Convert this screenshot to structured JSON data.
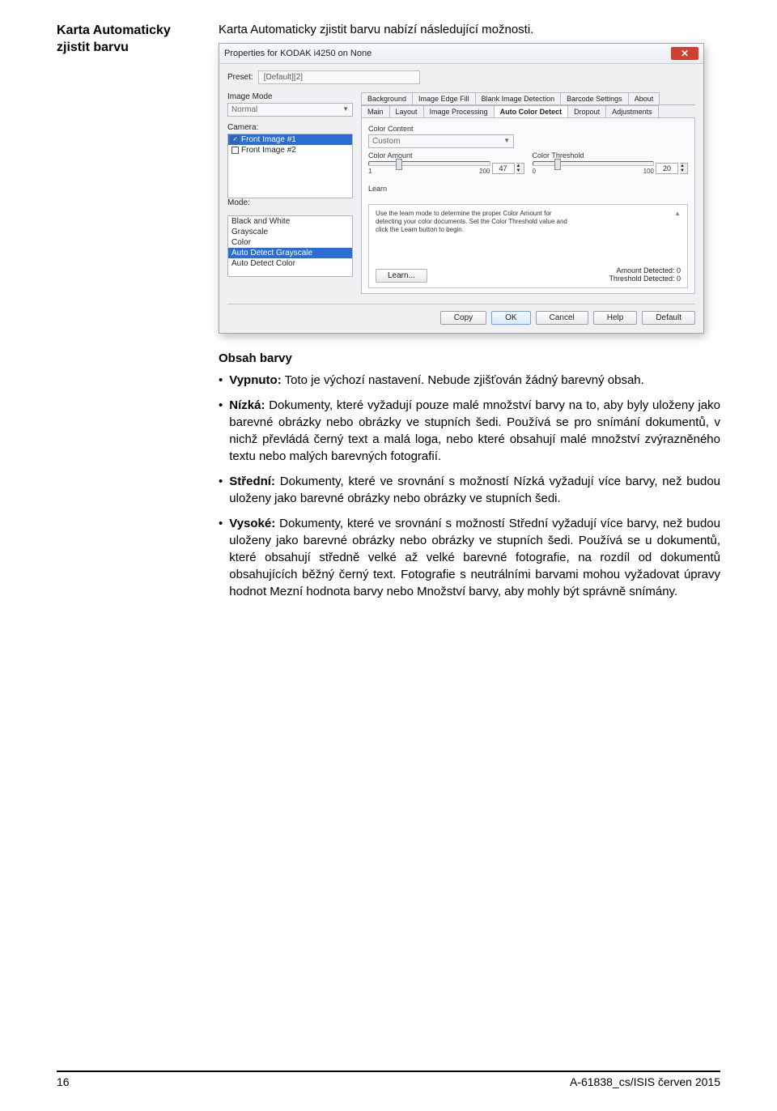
{
  "side_heading": "Karta Automaticky zjistit barvu",
  "intro": "Karta Automaticky zjistit barvu nabízí následující možnosti.",
  "dialog": {
    "title": "Properties for KODAK i4250 on None",
    "preset_label": "Preset:",
    "preset_value": "[Default][2]",
    "image_mode_label": "Image Mode",
    "image_mode_value": "Normal",
    "camera_label": "Camera:",
    "camera_items": [
      "Front Image #1",
      "Front Image #2"
    ],
    "mode_label": "Mode:",
    "mode_items": [
      "Black and White",
      "Grayscale",
      "Color",
      "Auto Detect Grayscale",
      "Auto Detect Color"
    ],
    "tabs_row1": [
      "Background",
      "Image Edge Fill",
      "Blank Image Detection",
      "Barcode Settings",
      "About"
    ],
    "tabs_row2": [
      "Main",
      "Layout",
      "Image Processing",
      "Auto Color Detect",
      "Dropout",
      "Adjustments"
    ],
    "color_content_label": "Color Content",
    "color_content_value": "Custom",
    "color_amount_label": "Color Amount",
    "color_amount_value": "47",
    "color_amount_min": "1",
    "color_amount_max": "200",
    "color_threshold_label": "Color Threshold",
    "color_threshold_value": "20",
    "color_threshold_min": "0",
    "color_threshold_max": "100",
    "learn_label": "Learn",
    "learn_text": "Use the learn mode to determine the proper Color Amount for detecting your color documents. Set the Color Threshold value and click the Learn button to begin.",
    "learn_button": "Learn...",
    "amount_detected": "Amount Detected:  0",
    "threshold_detected": "Threshold Detected:  0",
    "buttons": {
      "copy": "Copy",
      "ok": "OK",
      "cancel": "Cancel",
      "help": "Help",
      "default": "Default"
    }
  },
  "body": {
    "heading": "Obsah barvy",
    "bullets": [
      {
        "lead": "Vypnuto:",
        "text": " Toto je výchozí nastavení. Nebude zjišťován žádný barevný obsah."
      },
      {
        "lead": "Nízká:",
        "text": " Dokumenty, které vyžadují pouze malé množství barvy na to, aby byly uloženy jako barevné obrázky nebo obrázky ve stupních šedi. Používá se pro snímání dokumentů, v nichž převládá černý text a malá loga, nebo které obsahují malé množství zvýrazněného textu nebo malých barevných fotografií."
      },
      {
        "lead": "Střední:",
        "text": " Dokumenty, které ve srovnání s možností Nízká vyžadují více barvy, než budou uloženy jako barevné obrázky nebo obrázky ve stupních šedi."
      },
      {
        "lead": "Vysoké:",
        "text": " Dokumenty, které ve srovnání s možností Střední vyžadují více barvy, než budou uloženy jako barevné obrázky nebo obrázky ve stupních šedi. Používá se u dokumentů, které obsahují středně velké až velké barevné fotografie, na rozdíl od dokumentů obsahujících běžný černý text. Fotografie s neutrálními barvami mohou vyžadovat úpravy hodnot Mezní hodnota barvy nebo Množství barvy, aby mohly být správně snímány."
      }
    ]
  },
  "footer": {
    "page": "16",
    "docref": "A-61838_cs/ISIS  červen 2015"
  }
}
